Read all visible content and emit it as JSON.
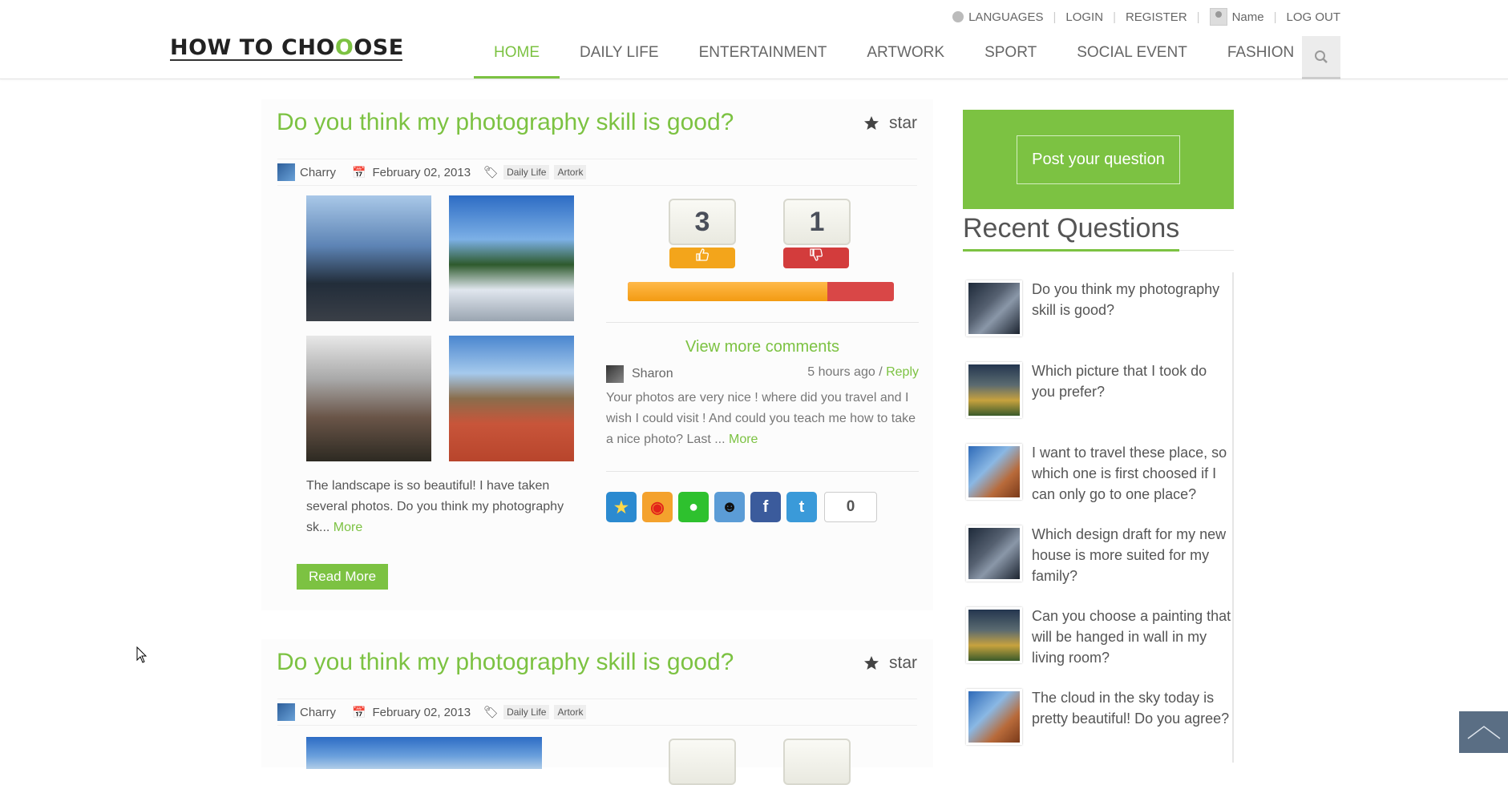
{
  "topbar": {
    "languages": "LANGUAGES",
    "login": "LOGIN",
    "register": "REGISTER",
    "username": "Name",
    "logout": "LOG OUT"
  },
  "logo": {
    "part1": "HOW TO CHO",
    "part2": "O",
    "part3": "OSE"
  },
  "nav": {
    "items": [
      "HOME",
      "DAILY LIFE",
      "ENTERTAINMENT",
      "ARTWORK",
      "SPORT",
      "SOCIAL EVENT",
      "FASHION"
    ],
    "active": "HOME"
  },
  "posts": [
    {
      "title": "Do you think my photography skill is good?",
      "star_label": "star",
      "author": "Charry",
      "date": "February 02, 2013",
      "tags": [
        "Daily Life",
        "Artork"
      ],
      "excerpt": "The landscape is so beautiful! I have taken several photos. Do you think my photography sk...",
      "excerpt_more": "More",
      "read_more": "Read More",
      "votes_up": "3",
      "votes_down": "1",
      "vote_up_fraction": 0.75,
      "view_more_comments": "View more comments",
      "comment": {
        "author": "Sharon",
        "time": "5 hours ago",
        "time_sep": " / ",
        "reply": "Reply",
        "text": "Your photos are very nice ! where did you travel and I wish I could visit ! And could you teach me how to take a nice photo? Last ... ",
        "more": "More"
      },
      "share_count": "0"
    },
    {
      "title": "Do you think my photography skill is good?",
      "star_label": "star",
      "author": "Charry",
      "date": "February 02, 2013",
      "tags": [
        "Daily Life",
        "Artork"
      ]
    }
  ],
  "sidebar": {
    "post_question": "Post your question",
    "recent_title": "Recent Questions",
    "questions": [
      "Do you think my photography skill is good?",
      "Which picture that I took do you prefer?",
      "I want to travel these place, so which one is first choosed if I can only go to one place?",
      "Which design draft for my new house is more suited for my family?",
      "Can you choose a painting that will be hanged in wall in my living room?",
      "The cloud in the sky today is pretty beautiful! Do you agree?"
    ]
  },
  "colors": {
    "accent": "#7cc242",
    "vote_up": "#f3a51b",
    "vote_down": "#d33c3c"
  },
  "icons": [
    "globe-icon",
    "user-icon",
    "search-icon",
    "star-icon",
    "calendar-icon",
    "tag-icon",
    "thumbs-up-icon",
    "thumbs-down-icon",
    "favorite-share-icon",
    "weibo-icon",
    "wechat-icon",
    "qq-icon",
    "facebook-icon",
    "twitter-icon",
    "back-to-top-icon"
  ]
}
